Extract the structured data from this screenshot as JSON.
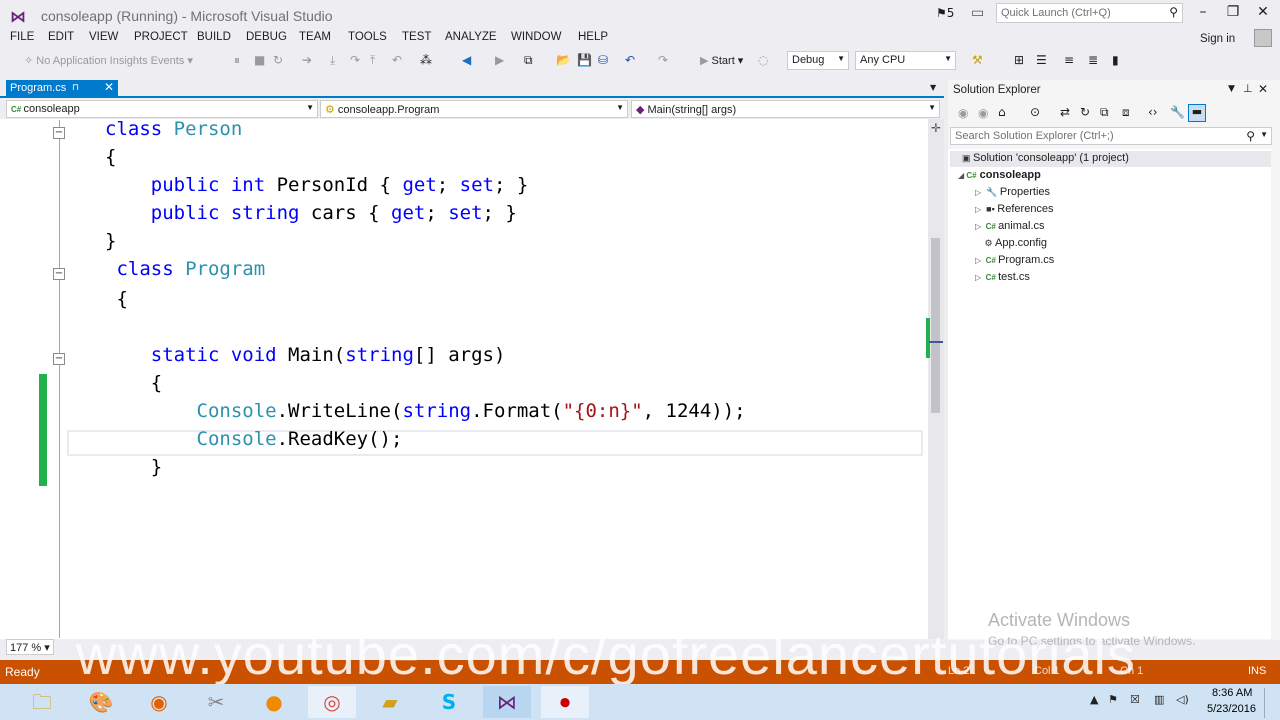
{
  "title_bar": {
    "title": "consoleapp (Running) - Microsoft Visual Studio",
    "notifications_count": "5",
    "quick_launch_placeholder": "Quick Launch (Ctrl+Q)"
  },
  "menu": {
    "items": [
      "FILE",
      "EDIT",
      "VIEW",
      "PROJECT",
      "BUILD",
      "DEBUG",
      "TEAM",
      "TOOLS",
      "TEST",
      "ANALYZE",
      "WINDOW",
      "HELP"
    ],
    "sign_in": "Sign in"
  },
  "toolbar": {
    "insights_label": "No Application Insights Events",
    "start_label": "Start",
    "configuration": "Debug",
    "platform": "Any CPU"
  },
  "editor": {
    "tab_label": "Program.cs",
    "nav_project": "consoleapp",
    "nav_class": "consoleapp.Program",
    "nav_member": "Main(string[] args)",
    "zoom": "177 %"
  },
  "code_lines": [
    [
      {
        "t": "class ",
        "c": "kw"
      },
      {
        "t": "Person",
        "c": "ty"
      }
    ],
    [
      {
        "t": "{",
        "c": ""
      }
    ],
    [
      {
        "t": "    ",
        "c": ""
      },
      {
        "t": "public ",
        "c": "kw"
      },
      {
        "t": "int ",
        "c": "kw"
      },
      {
        "t": "PersonId { ",
        "c": ""
      },
      {
        "t": "get",
        "c": "kw"
      },
      {
        "t": "; ",
        "c": ""
      },
      {
        "t": "set",
        "c": "kw"
      },
      {
        "t": "; }",
        "c": ""
      }
    ],
    [
      {
        "t": "    ",
        "c": ""
      },
      {
        "t": "public ",
        "c": "kw"
      },
      {
        "t": "string ",
        "c": "kw"
      },
      {
        "t": "cars { ",
        "c": ""
      },
      {
        "t": "get",
        "c": "kw"
      },
      {
        "t": "; ",
        "c": ""
      },
      {
        "t": "set",
        "c": "kw"
      },
      {
        "t": "; }",
        "c": ""
      }
    ],
    [
      {
        "t": "}",
        "c": ""
      }
    ],
    [
      {
        "t": " ",
        "c": ""
      },
      {
        "t": "class ",
        "c": "kw"
      },
      {
        "t": "Program",
        "c": "ty"
      }
    ],
    [
      {
        "t": " {",
        "c": ""
      }
    ],
    [],
    [
      {
        "t": "    ",
        "c": ""
      },
      {
        "t": "static ",
        "c": "kw"
      },
      {
        "t": "void ",
        "c": "kw"
      },
      {
        "t": "Main(",
        "c": ""
      },
      {
        "t": "string",
        "c": "kw"
      },
      {
        "t": "[] args)",
        "c": ""
      }
    ],
    [
      {
        "t": "    {",
        "c": ""
      }
    ],
    [
      {
        "t": "        ",
        "c": ""
      },
      {
        "t": "Console",
        "c": "ty"
      },
      {
        "t": ".WriteLine(",
        "c": ""
      },
      {
        "t": "string",
        "c": "kw"
      },
      {
        "t": ".Format(",
        "c": ""
      },
      {
        "t": "\"{0:n}\"",
        "c": "st"
      },
      {
        "t": ", 1244));",
        "c": ""
      }
    ],
    [
      {
        "t": "        ",
        "c": ""
      },
      {
        "t": "Console",
        "c": "ty"
      },
      {
        "t": ".ReadKey();",
        "c": ""
      }
    ],
    [
      {
        "t": "    }",
        "c": ""
      }
    ]
  ],
  "solution_explorer": {
    "title": "Solution Explorer",
    "search_placeholder": "Search Solution Explorer (Ctrl+;)",
    "solution_label": "Solution 'consoleapp' (1 project)",
    "project_label": "consoleapp",
    "items": [
      {
        "label": "Properties",
        "icon": "wrench-icon"
      },
      {
        "label": "References",
        "icon": "references-icon"
      },
      {
        "label": "animal.cs",
        "icon": "csharp-file-icon"
      },
      {
        "label": "App.config",
        "icon": "config-file-icon"
      },
      {
        "label": "Program.cs",
        "icon": "csharp-file-icon"
      },
      {
        "label": "test.cs",
        "icon": "csharp-file-icon"
      }
    ]
  },
  "status_bar": {
    "state": "Ready",
    "ln": "Ln 2",
    "col": "Col 1",
    "ch": "Ch 1",
    "mode": "INS"
  },
  "overlay": {
    "watermark": "www.youtube.com/c/gofreelancertutorials",
    "activate_title": "Activate Windows",
    "activate_sub": "Go to PC settings to activate Windows."
  },
  "taskbar": {
    "time": "8:36 AM",
    "date": "5/23/2016"
  },
  "colors": {
    "accent": "#007acc",
    "status_bar": "#ca5100",
    "keyword": "#0000ff",
    "type": "#2b91af",
    "string": "#a31515",
    "change_marker": "#22b14c"
  }
}
